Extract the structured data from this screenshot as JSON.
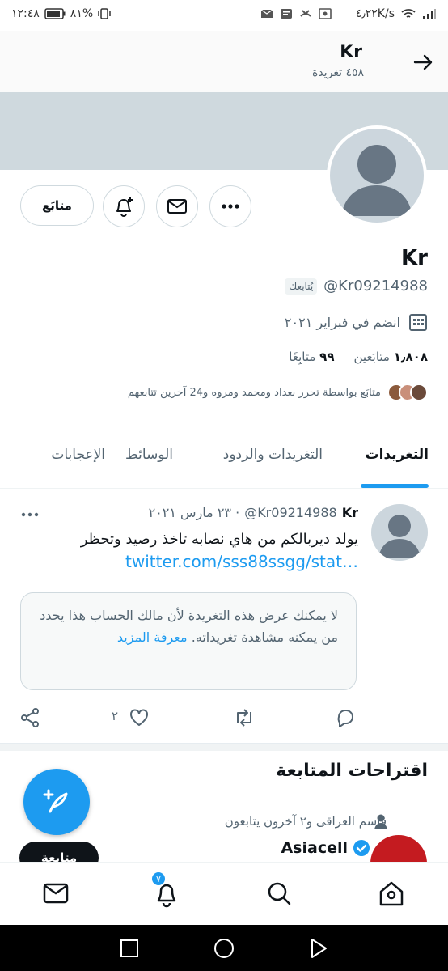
{
  "status_bar": {
    "time": "١٢:٤٨",
    "battery": "٨١%",
    "speed": "٤٫٢٢K/s",
    "network": "3G"
  },
  "header": {
    "title": "Kr",
    "subtitle": "٤٥٨ تغريدة"
  },
  "profile": {
    "display_name": "Kr",
    "handle": "@Kr09214988",
    "follows_you": "يُتابعك",
    "joined": "انضم في فبراير ٢٠٢١",
    "followers_count": "١٫٨٠٨",
    "followers_label": "متابَعين",
    "following_count": "٩٩",
    "following_label": "متابِعًا",
    "followed_by": "متابَع بواسطة تحرر بغداد ومحمد ومروه و24 آخرين تتابعهم",
    "follow_button": "متابَع"
  },
  "tabs": [
    {
      "label": "التغريدات"
    },
    {
      "label": "التغريدات والردود"
    },
    {
      "label": "الوسائط"
    },
    {
      "label": "الإعجابات"
    }
  ],
  "tweet": {
    "name": "Kr",
    "handle": "@Kr09214988",
    "date": "· ٢٣ مارس ٢٠٢١",
    "text": "يولد ديربالكم من هاي نصابه تاخذ رصيد وتحظر",
    "link": "twitter.com/sss88ssgg/stat…",
    "withheld": "لا يمكنك عرض هذه التغريدة لأن مالك الحساب هذا يحدد من يمكنه مشاهدة تغريداته.",
    "learn_more": "معرفة المزيد",
    "like_count": "٢"
  },
  "suggestions": {
    "title": "اقتراحات المتابعة",
    "social": "قاسم العراقى و٢ آخرون يتابعون",
    "name": "Asiacell",
    "follow_button": "متابعة"
  },
  "bottom_nav": {
    "notification_badge": "٧"
  },
  "colors": {
    "accent": "#1d9bf0",
    "banner": "#cfd9de",
    "text": "#0f1419",
    "secondary": "#536471"
  }
}
